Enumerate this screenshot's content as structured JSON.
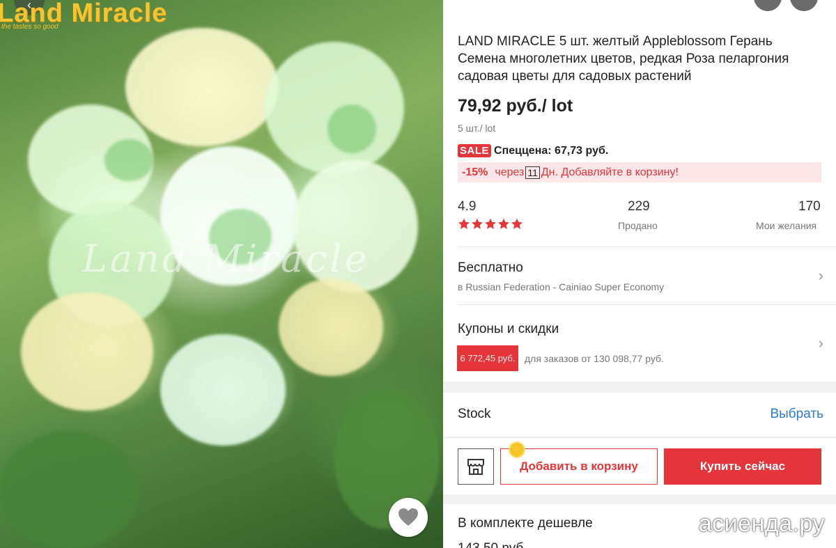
{
  "image": {
    "logo": "Land Miracle",
    "logo_tagline": "the tastes so good",
    "watermark": "Land Miracle"
  },
  "product": {
    "title": "LAND MIRACLE 5 шт. желтый Appleblossom Герань Семена многолетних цветов, редкая Роза пеларгония садовая цветы для садовых растений",
    "price": "79,92 руб./ lot",
    "unit": "5 шт./ lot",
    "sale_badge": "SALE",
    "special_price": "Спеццена: 67,73 руб.",
    "promo": {
      "discount": "-15%",
      "before_days": "через",
      "days": "11",
      "after_days": "Дн. Добавляйте в корзину!"
    }
  },
  "stats": {
    "rating": "4.9",
    "stars": 5,
    "sold_count": "229",
    "sold_label": "Продано",
    "wishes_count": "170",
    "wishes_label": "Мои желания"
  },
  "shipping": {
    "title": "Бесплатно",
    "subtitle": "в Russian Federation - Cainiao Super Economy"
  },
  "coupons": {
    "title": "Купоны и скидки",
    "amount": "6 772,45 руб.",
    "condition": "для заказов от 130 098,77 руб."
  },
  "stock": {
    "label": "Stock",
    "select": "Выбрать"
  },
  "actions": {
    "add_to_cart": "Добавить в корзину",
    "buy_now": "Купить сейчас"
  },
  "bundle": {
    "title": "В комплекте дешевле",
    "price": "143,50 руб."
  },
  "site_watermark": "асиенда.ру",
  "colors": {
    "accent": "#e4353a",
    "link": "#2b7bd1",
    "promo_bg": "#fde6e8"
  }
}
